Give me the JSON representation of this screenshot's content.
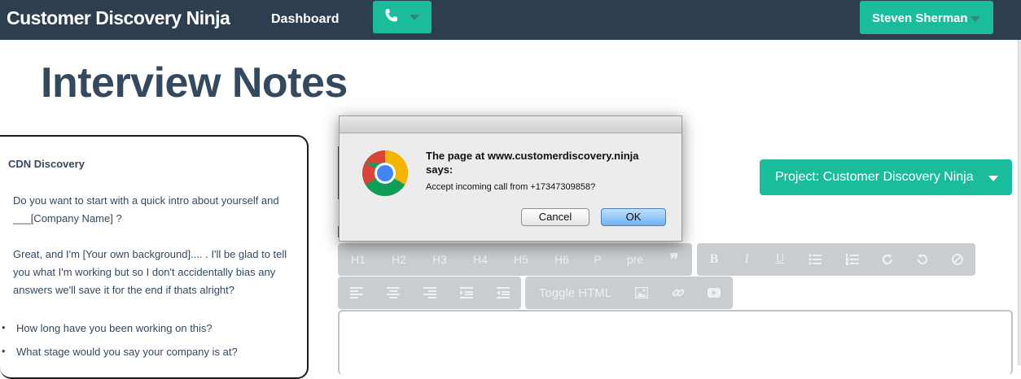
{
  "navbar": {
    "brand": "Customer Discovery Ninja",
    "dashboard_link": "Dashboard",
    "user_name": "Steven Sherman"
  },
  "page": {
    "title": "Interview Notes"
  },
  "script": {
    "title": "CDN Discovery",
    "para1_line1": "Do you want to start with a quick intro about yourself and",
    "para1_line2": "___[Company Name] ?",
    "para2_line1": "Great, and I'm [Your own background].... . I'll be glad to tell",
    "para2_line2": "you what I'm working but so I don't accidentally bias any",
    "para2_line3": "answers we'll save it for the end if thats alright?",
    "bullets": [
      "How long have you been working on this?",
      "What stage would you say your company is at?"
    ]
  },
  "project_button": {
    "label": "Project: Customer Discovery Ninja"
  },
  "toolbar": {
    "headings": [
      "H1",
      "H2",
      "H3",
      "H4",
      "H5",
      "H6",
      "P",
      "pre"
    ],
    "toggle_html": "Toggle HTML"
  },
  "dialog": {
    "heading_line1": "The page at www.customerdiscovery.ninja",
    "heading_line2": "says:",
    "message": "Accept incoming call from +17347309858?",
    "cancel_label": "Cancel",
    "ok_label": "OK"
  },
  "colors": {
    "navbar": "#2c3e50",
    "accent": "#1abc9c",
    "title_text": "#34495e",
    "toolbar": "#c9cdd0"
  }
}
